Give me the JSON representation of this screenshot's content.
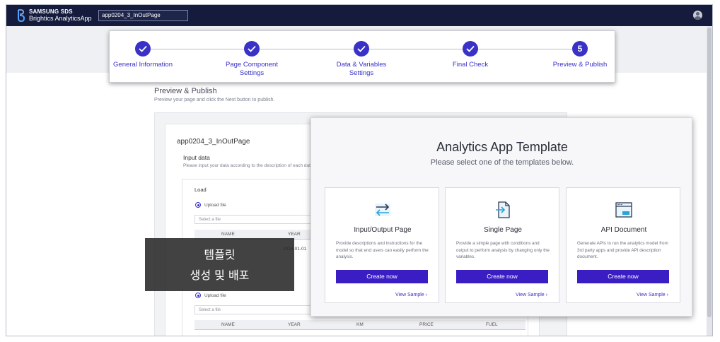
{
  "header": {
    "brand_line1": "SAMSUNG SDS",
    "brand_line2": "Brightics AnalyticsApp",
    "app_name": "app0204_3_InOutPage",
    "user_icon": "user-avatar-icon"
  },
  "stepper": {
    "steps": [
      {
        "label_line1": "General Information",
        "label_line2": "",
        "state": "done"
      },
      {
        "label_line1": "Page Component",
        "label_line2": "Settings",
        "state": "done"
      },
      {
        "label_line1": "Data & Variables",
        "label_line2": "Settings",
        "state": "done"
      },
      {
        "label_line1": "Final Check",
        "label_line2": "",
        "state": "done"
      },
      {
        "label_line1": "Preview & Publish",
        "label_line2": "",
        "state": "current",
        "number": "5"
      }
    ],
    "check_icon": "check-icon",
    "accent_color": "#3a31c7"
  },
  "page": {
    "title": "Preview & Publish",
    "subtitle": "Preview your page and click the Next button to publish.",
    "card_title": "app0204_3_InOutPage",
    "input_heading": "Input data",
    "input_desc": "Please input your data according to the description of each data",
    "load_label": "Load",
    "upload_file_label": "Upload file",
    "select_file_placeholder": "Select a file",
    "table1_headers": [
      "NAME",
      "YEAR"
    ],
    "table1_date": "2018-01-01",
    "upload_file_label2": "Upload file",
    "select_file_placeholder2": "Select a file",
    "table2_headers": [
      "NAME",
      "YEAR",
      "KM",
      "PRICE",
      "FUEL"
    ]
  },
  "overlay": {
    "line1": "템플릿",
    "line2": "생성 및 배포"
  },
  "modal": {
    "title": "Analytics App Template",
    "subtitle": "Please select one of the templates below.",
    "templates": [
      {
        "name": "Input/Output Page",
        "icon": "swap-arrows-icon",
        "desc": "Provide descriptions and instructions for the model so that end users can easily perform the analysis.",
        "button": "Create now",
        "link": "View Sample"
      },
      {
        "name": "Single Page",
        "icon": "document-arrow-icon",
        "desc": "Provide a simple page with conditions and output to perform analysis by changing only the variables.",
        "button": "Create now",
        "link": "View Sample"
      },
      {
        "name": "API Document",
        "icon": "api-window-icon",
        "desc": "Generate APIs to run the analytics model from 3rd party apps and provide API description document.",
        "button": "Create now",
        "link": "View Sample"
      }
    ]
  }
}
